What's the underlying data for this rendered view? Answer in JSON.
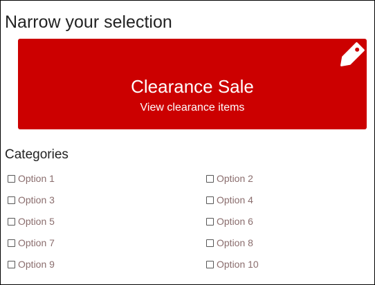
{
  "header": {
    "title": "Narrow your selection"
  },
  "banner": {
    "title": "Clearance Sale",
    "subtitle": "View clearance items",
    "icon": "tag-icon",
    "background_color": "#cc0000",
    "text_color": "#ffffff"
  },
  "categories": {
    "heading": "Categories",
    "options": [
      {
        "label": "Option 1",
        "checked": false
      },
      {
        "label": "Option 2",
        "checked": false
      },
      {
        "label": "Option 3",
        "checked": false
      },
      {
        "label": "Option 4",
        "checked": false
      },
      {
        "label": "Option 5",
        "checked": false
      },
      {
        "label": "Option 6",
        "checked": false
      },
      {
        "label": "Option 7",
        "checked": false
      },
      {
        "label": "Option 8",
        "checked": false
      },
      {
        "label": "Option 9",
        "checked": false
      },
      {
        "label": "Option 10",
        "checked": false
      }
    ],
    "option_text_color": "#8a6d6d"
  }
}
